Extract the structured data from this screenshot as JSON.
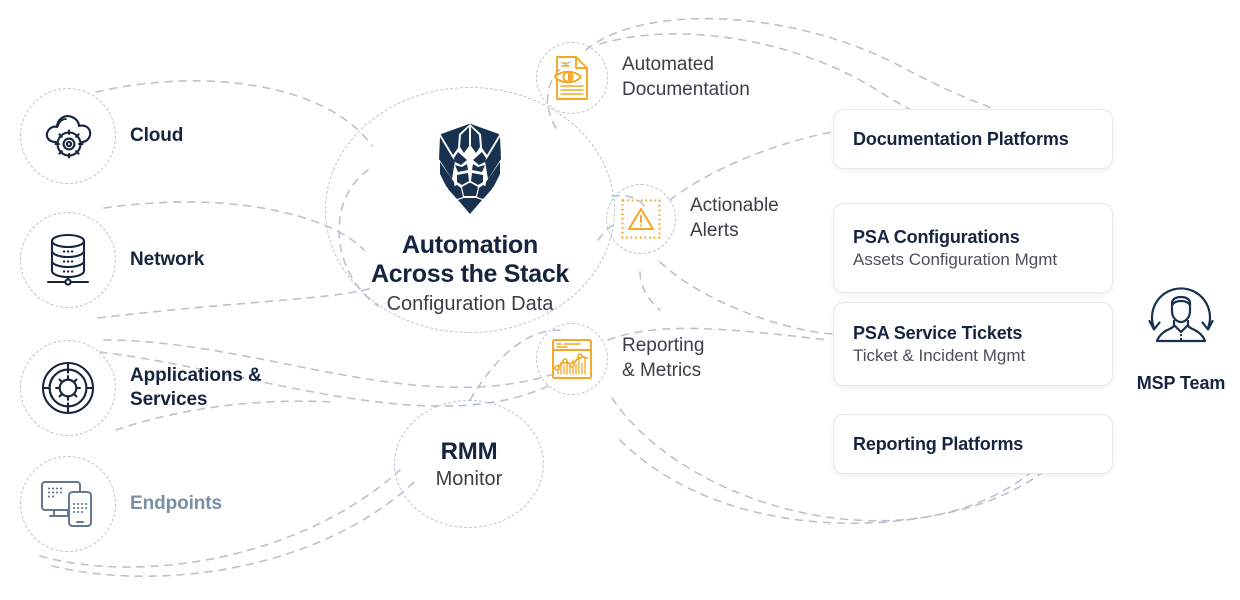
{
  "diagram": {
    "title": "Automation Across the Stack",
    "colors": {
      "navy": "#17243f",
      "amber": "#f5a623",
      "muted_slate": "#7b8da6",
      "dashed_line": "#b9c3d0",
      "body_text": "#3b3f45",
      "card_border": "#e6e8ec"
    }
  },
  "sources": [
    {
      "id": "cloud",
      "label": "Cloud",
      "icon": "cloud-gear-icon",
      "muted": false
    },
    {
      "id": "network",
      "label": "Network",
      "icon": "database-stack-icon",
      "muted": false
    },
    {
      "id": "apps",
      "label": "Applications &\nServices",
      "icon": "gear-disc-icon",
      "muted": false
    },
    {
      "id": "endpoints",
      "label": "Endpoints",
      "icon": "devices-icon",
      "muted": true
    }
  ],
  "hub": {
    "logo_icon": "lion-shield-logo",
    "title": "Automation\nAcross the Stack",
    "subtitle": "Configuration Data"
  },
  "rmm": {
    "title": "RMM",
    "subtitle": "Monitor"
  },
  "outputs": [
    {
      "id": "automated-documentation",
      "label": "Automated\nDocumentation",
      "icon": "document-eye-icon"
    },
    {
      "id": "actionable-alerts",
      "label": "Actionable\nAlerts",
      "icon": "alert-triangle-icon"
    },
    {
      "id": "reporting-metrics",
      "label": "Reporting\n& Metrics",
      "icon": "chart-report-icon"
    }
  ],
  "destinations": [
    {
      "id": "documentation-platforms",
      "title": "Documentation Platforms",
      "subtitle": ""
    },
    {
      "id": "psa-configurations",
      "title": "PSA Configurations",
      "subtitle": "Assets Configuration Mgmt"
    },
    {
      "id": "psa-service-tickets",
      "title": "PSA Service Tickets",
      "subtitle": "Ticket & Incident Mgmt"
    },
    {
      "id": "reporting-platforms",
      "title": "Reporting Platforms",
      "subtitle": ""
    }
  ],
  "team": {
    "label": "MSP Team",
    "icon": "user-circular-arrows-icon"
  }
}
